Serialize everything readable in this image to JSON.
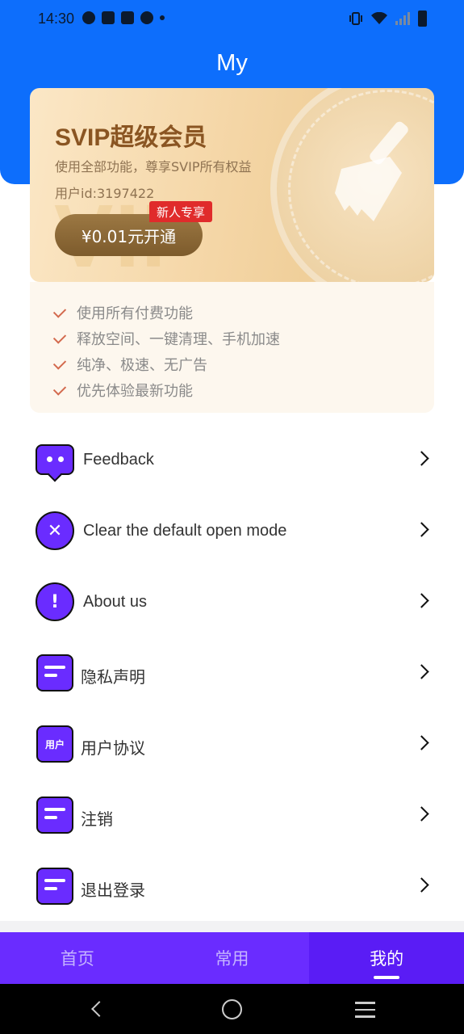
{
  "status_bar": {
    "time": "14:30"
  },
  "header": {
    "title": "My"
  },
  "vip": {
    "title": "SVIP超级会员",
    "subtitle": "使用全部功能，尊享SVIP所有权益",
    "user_id": "用户id:3197422",
    "button_label": "¥0.01元开通",
    "badge": "新人专享",
    "watermark": "VIP"
  },
  "features": [
    "使用所有付费功能",
    "释放空间、一键清理、手机加速",
    "纯净、极速、无广告",
    "优先体验最新功能"
  ],
  "menu": [
    {
      "label": "Feedback",
      "icon": "chat-icon"
    },
    {
      "label": "Clear the default open mode",
      "icon": "close-circle-icon",
      "glyph": "✕"
    },
    {
      "label": "About us",
      "icon": "info-circle-icon",
      "glyph": "!"
    },
    {
      "label": "隐私声明",
      "icon": "document-icon"
    },
    {
      "label": "用户协议",
      "icon": "user-agreement-icon",
      "glyph": "用户"
    },
    {
      "label": "注销",
      "icon": "document-icon"
    },
    {
      "label": "退出登录",
      "icon": "document-icon"
    }
  ],
  "tabs": [
    {
      "label": "首页",
      "active": false
    },
    {
      "label": "常用",
      "active": false
    },
    {
      "label": "我的",
      "active": true
    }
  ],
  "colors": {
    "header_blue": "#0d6efc",
    "accent_purple": "#6a2cff",
    "vip_gold": "#8a5522",
    "badge_red": "#e02b2b"
  }
}
